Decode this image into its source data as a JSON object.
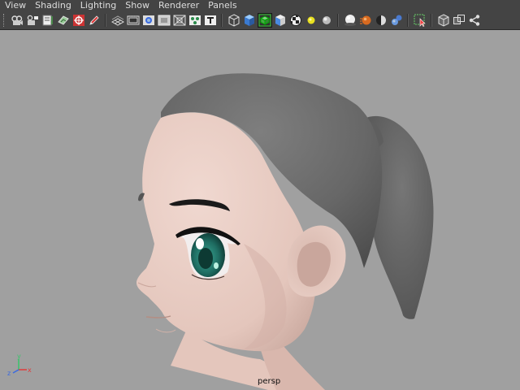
{
  "menu": {
    "items": [
      {
        "label": "View"
      },
      {
        "label": "Shading"
      },
      {
        "label": "Lighting"
      },
      {
        "label": "Show"
      },
      {
        "label": "Renderer"
      },
      {
        "label": "Panels"
      }
    ]
  },
  "toolbar": {
    "groups": [
      [
        "select-camera-icon",
        "camera-attributes-icon",
        "bookmarks-icon",
        "image-plane-icon",
        "two-d-pan-zoom-icon",
        "grease-pencil-icon"
      ],
      [
        "grid-icon",
        "film-gate-icon",
        "resolution-gate-icon",
        "gate-mask-icon",
        "field-chart-icon",
        "safe-action-icon",
        "safe-title-icon"
      ],
      [
        "wireframe-icon",
        "smooth-shade-icon",
        "wireframe-on-shaded-icon",
        "default-material-icon",
        "textured-icon",
        "use-all-lights-icon",
        "shadows-icon"
      ],
      [
        "screen-space-ambient-occlusion-icon",
        "motion-blur-icon",
        "multisample-anti-aliasing-icon",
        "depth-of-field-icon"
      ],
      [
        "isolate-select-icon"
      ],
      [
        "xray-icon",
        "xray-active-components-icon",
        "xray-joints-icon"
      ]
    ]
  },
  "viewport": {
    "camera_label": "persp",
    "background_color": "#a0a0a0",
    "axis": {
      "x_label": "x",
      "y_label": "y",
      "z_label": "z"
    },
    "colors": {
      "skin": "#e8cfc6",
      "hair": "#6c6c6c",
      "eye_iris": "#1f6e63",
      "brow": "#1a1a1a",
      "axis_x": "#e03a3a",
      "axis_y": "#39c46a",
      "axis_z": "#3a6ae0"
    }
  }
}
